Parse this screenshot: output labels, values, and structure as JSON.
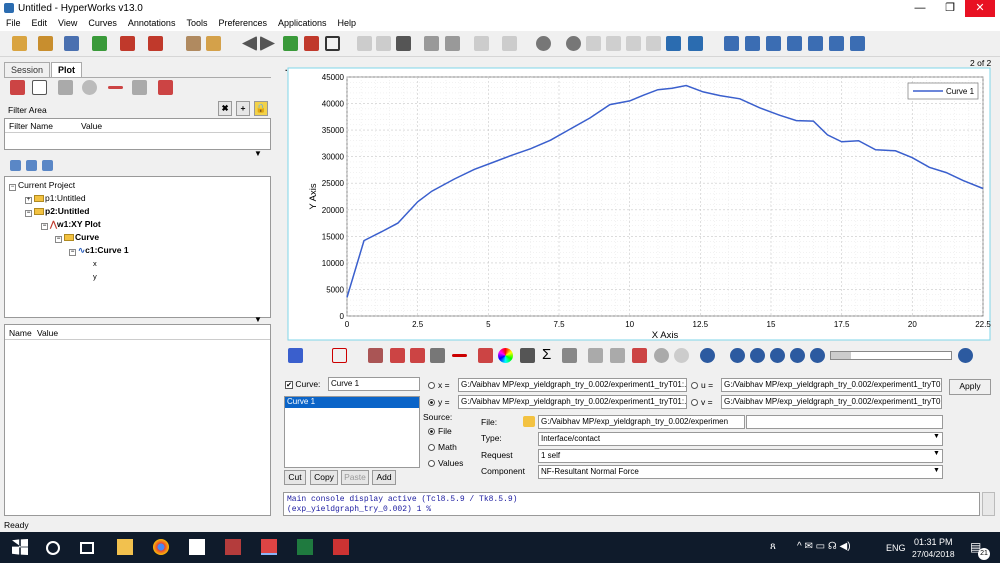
{
  "window": {
    "title": "Untitled - HyperWorks v13.0",
    "minimize": "—",
    "restore": "❐",
    "close": "✕"
  },
  "menu": [
    "File",
    "Edit",
    "View",
    "Curves",
    "Annotations",
    "Tools",
    "Preferences",
    "Applications",
    "Help"
  ],
  "left": {
    "tabs": {
      "session": "Session",
      "plot": "Plot"
    },
    "filter_area_label": "Filter Area",
    "filter_headers": {
      "name": "Filter Name",
      "value": "Value"
    },
    "tree": {
      "root": "Current Project",
      "p1": "p1:Untitled",
      "p2": "p2:Untitled",
      "w1": "w1:XY Plot",
      "curve_folder": "Curve",
      "c1": "c1:Curve 1",
      "x": "x",
      "y": "y"
    },
    "props_headers": {
      "name": "Name",
      "value": "Value"
    }
  },
  "plot": {
    "page_indicator": "2 of 2",
    "dots": "....",
    "chart_data": {
      "type": "line",
      "xlabel": "X Axis",
      "ylabel": "Y Axis",
      "xlim": [
        0,
        22.5
      ],
      "ylim": [
        0,
        45000
      ],
      "xticks": [
        "0",
        "2.5",
        "5",
        "7.5",
        "10",
        "12.5",
        "15",
        "17.5",
        "20",
        "22.5"
      ],
      "yticks": [
        "0",
        "5000",
        "10000",
        "15000",
        "20000",
        "25000",
        "30000",
        "35000",
        "40000",
        "45000"
      ],
      "grid": true,
      "legend": "top-right",
      "series": [
        {
          "name": "Curve 1",
          "color": "#3a5fcd",
          "x": [
            0,
            0.6,
            1.2,
            1.8,
            2.5,
            3,
            3.8,
            4.5,
            5.2,
            5.8,
            6.5,
            7.2,
            7.9,
            8.6,
            9.3,
            10,
            10.5,
            11,
            11.5,
            12,
            12.6,
            13.2,
            13.9,
            14.6,
            15.3,
            15.9,
            16.5,
            17,
            17.5,
            18.1,
            18.7,
            19.4,
            20,
            20.6,
            21.2,
            21.8,
            22.5
          ],
          "y": [
            3500,
            14200,
            15800,
            17500,
            21500,
            23500,
            25800,
            27600,
            29000,
            30200,
            31500,
            33100,
            35200,
            37300,
            39800,
            40500,
            41600,
            42600,
            42900,
            43400,
            42200,
            41500,
            40900,
            39200,
            37800,
            36800,
            36700,
            34100,
            32800,
            33000,
            31300,
            31100,
            29800,
            28000,
            27000,
            25500,
            24000
          ]
        }
      ]
    }
  },
  "curve": {
    "checkbox_label": "Curve:",
    "name_value": "Curve 1",
    "list": [
      "Curve 1"
    ],
    "x_label": "x =",
    "x_value": "G:/Vaibhav MP/exp_yieldgraph_try_0.002/experiment1_tryT01:...",
    "y_label": "y =",
    "y_value": "G:/Vaibhav MP/exp_yieldgraph_try_0.002/experiment1_tryT01:...",
    "u_label": "u =",
    "u_value": "G:/Vaibhav MP/exp_yieldgraph_try_0.002/experiment1_tryT01:...",
    "v_label": "v =",
    "v_value": "G:/Vaibhav MP/exp_yieldgraph_try_0.002/experiment1_tryT01:...",
    "apply": "Apply",
    "source_label": "Source:",
    "sources": [
      "File",
      "Math",
      "Values"
    ],
    "file_label": "File:",
    "file_value": "G:/Vaibhav MP/exp_yieldgraph_try_0.002/experimen",
    "type_label": "Type:",
    "type_value": "Interface/contact",
    "request_label": "Request",
    "request_value": "1 self",
    "component_label": "Component",
    "component_value": "NF-Resultant Normal Force",
    "buttons": {
      "cut": "Cut",
      "copy": "Copy",
      "paste": "Paste",
      "add": "Add"
    }
  },
  "console": {
    "line1": "Main console display active (Tcl8.5.9 / Tk8.5.9)",
    "line2": "(exp_yieldgraph_try_0.002) 1 %"
  },
  "status": "Ready",
  "taskbar": {
    "time": "01:31 PM",
    "date": "27/04/2018",
    "lang": "ENG",
    "notif": "21"
  }
}
